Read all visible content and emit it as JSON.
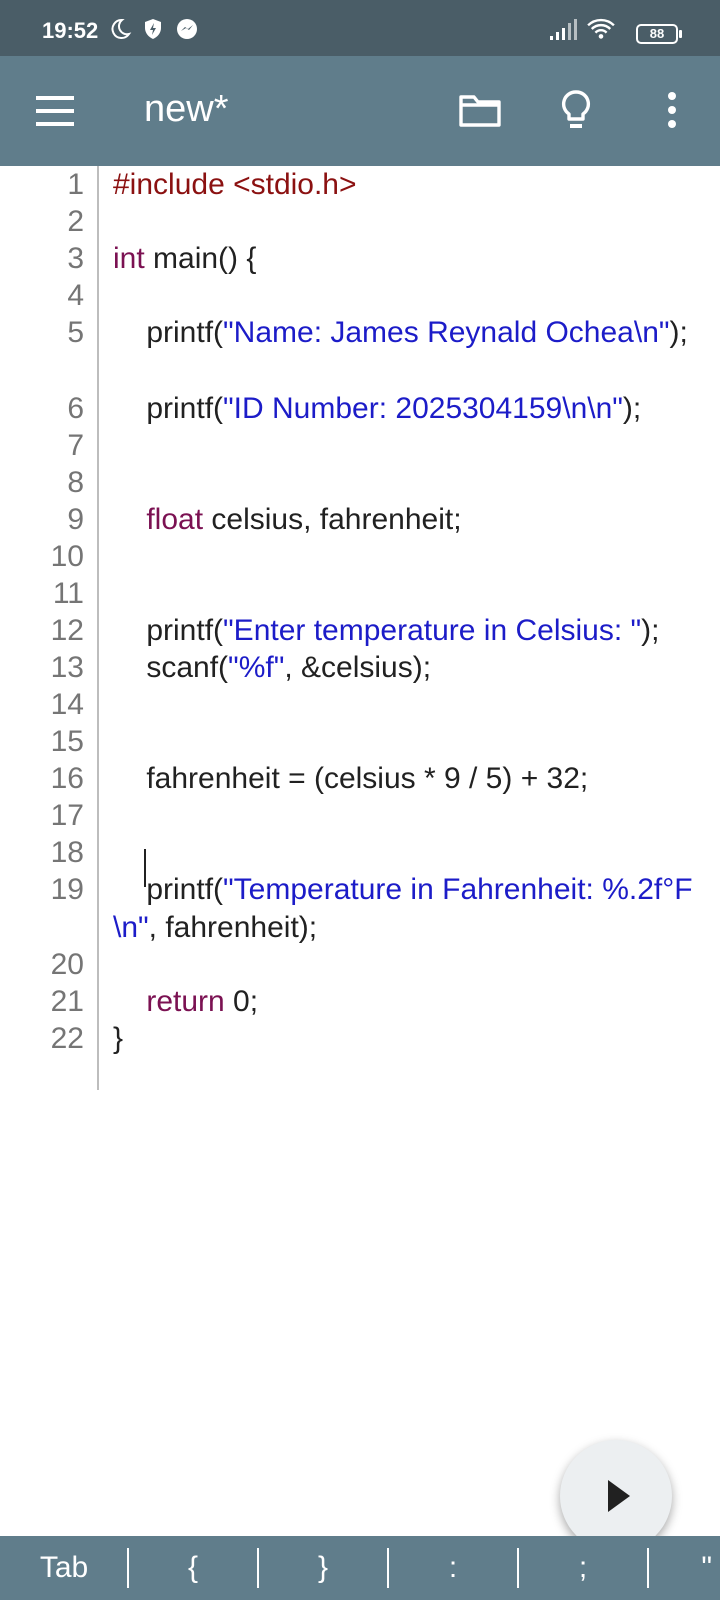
{
  "status_bar": {
    "time": "19:52",
    "left_icons": [
      "moon-icon",
      "shield-icon",
      "messenger-icon"
    ],
    "right_icons": [
      "signal-icon",
      "wifi-icon",
      "battery-icon"
    ],
    "battery": "88"
  },
  "app_bar": {
    "title": "new*",
    "actions": [
      "menu-icon",
      "folder-icon",
      "lightbulb-icon",
      "more-vert-icon"
    ]
  },
  "editor": {
    "line_numbers": [
      "1",
      "2",
      "3",
      "4",
      "5",
      "6",
      "7",
      "8",
      "9",
      "10",
      "11",
      "12",
      "13",
      "14",
      "15",
      "16",
      "17",
      "18",
      "19",
      "20",
      "21",
      "22"
    ],
    "lines": {
      "l1": {
        "pp": "#include <stdio.h>"
      },
      "l3": {
        "kw": "int",
        "rest": " main() {"
      },
      "l5": {
        "a": "    printf(",
        "s": "\"Name: James Reynald Ochea\\n\"",
        "b": ");"
      },
      "l6": {
        "a": "    printf(",
        "s": "\"ID Number: 2025304159\\n\\n\"",
        "b": ");"
      },
      "l9": {
        "indent": "    ",
        "kw": "float",
        "rest": " celsius, fahrenheit;"
      },
      "l12": {
        "a": "    printf(",
        "s": "\"Enter temperature in Celsius: \"",
        "b": ");"
      },
      "l13": {
        "a": "    scanf(",
        "s": "\"%f\"",
        "b": ", &celsius);"
      },
      "l16": {
        "a": "    fahrenheit = (celsius * 9 / 5) + 32;"
      },
      "l19": {
        "a": "    printf(",
        "s": "\"Temperature in Fahrenheit: %.2f°F\\n\"",
        "b": ", fahrenheit);"
      },
      "l21": {
        "indent": "    ",
        "kw": "return",
        "rest": " 0;"
      },
      "l22": {
        "a": "}"
      }
    }
  },
  "fab": {
    "icon": "play-icon"
  },
  "key_bar": {
    "keys": [
      "Tab",
      "{",
      "}",
      ":",
      ";",
      "\""
    ]
  }
}
